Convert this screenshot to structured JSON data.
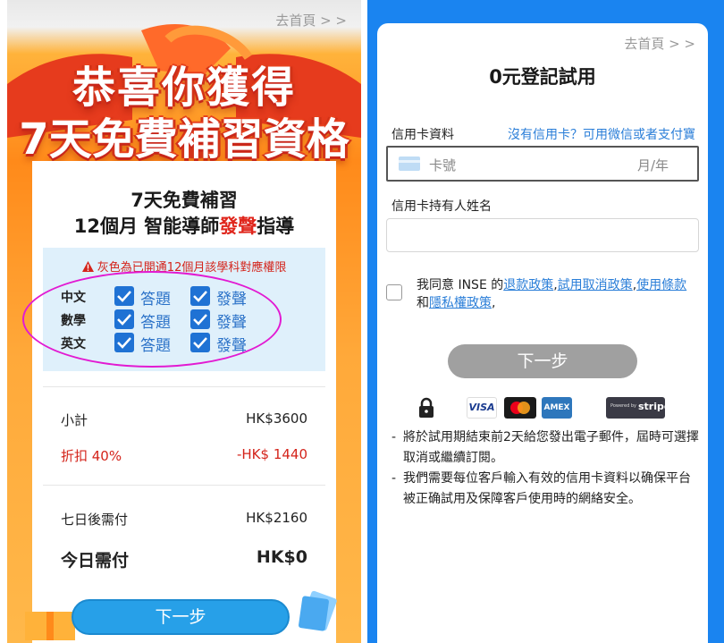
{
  "left": {
    "home_link": "去首頁 > >",
    "hero_line1": "恭喜你獲得",
    "hero_line2": "7天免費補習資格",
    "card_title1": "7天免費補習",
    "card_title2_prefix": "12個月 智能導師",
    "card_title2_highlight": "發聲",
    "card_title2_suffix": "指導",
    "warning": "灰色為已開通12個月該學科對應權限",
    "subjects": [
      {
        "name": "中文",
        "opt1": "答題",
        "opt2": "發聲"
      },
      {
        "name": "數學",
        "opt1": "答題",
        "opt2": "發聲"
      },
      {
        "name": "英文",
        "opt1": "答題",
        "opt2": "發聲"
      }
    ],
    "subtotal_label": "小計",
    "subtotal_value": "HK$3600",
    "discount_label": "折扣 40%",
    "discount_value": "-HK$ 1440",
    "after7_label": "七日後需付",
    "after7_value": "HK$2160",
    "today_label": "今日需付",
    "today_value": "HK$0",
    "next_button": "下一步"
  },
  "right": {
    "home_link": "去首頁 > >",
    "title": "0元登記試用",
    "cc_label": "信用卡資料",
    "cc_link": "沒有信用卡？可用微信或者支付寶",
    "cc_number_placeholder": "卡號",
    "cc_expiry_placeholder": "月/年",
    "name_label": "信用卡持有人姓名",
    "agree_prefix": "我同意 INSE 的",
    "link_refund": "退款政策",
    "sep1": ",",
    "link_cancel": "試用取消政策",
    "sep2": ",",
    "link_terms": "使用條款",
    "and": "和",
    "link_privacy": "隱私權政策",
    "sep3": ",",
    "next_button": "下一步",
    "payments": {
      "visa": "VISA",
      "amex": "AMEX",
      "stripe_small": "Powered by",
      "stripe": "stripe"
    },
    "note1": "將於試用期結束前2天給您發出電子郵件，屆時可選擇取消或繼續訂閱。",
    "note2": "我們需要每位客戶輸入有效的信用卡資料以确保平台被正确試用及保障客戶使用時的網絡安全。"
  },
  "colors": {
    "accent_blue": "#1a84f0",
    "check_blue": "#1f72d4",
    "warning_red": "#d4241b",
    "orange": "#ff8a1a"
  }
}
